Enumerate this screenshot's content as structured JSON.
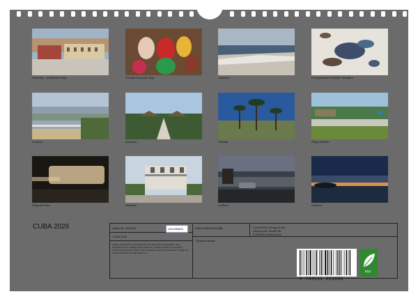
{
  "calendar": {
    "title": "CUBA 2026"
  },
  "photos": [
    {
      "caption": "Havanna - La Habana Vieja",
      "icon": "plaza-photo"
    },
    {
      "caption": "Trinidad Souvenir Shop",
      "icon": "souvenir-photo"
    },
    {
      "caption": "Varadero",
      "icon": "beach-photo"
    },
    {
      "caption": "Portugiesische Galeere, Varadero",
      "icon": "jellyfish-photo"
    },
    {
      "caption": "La Boca",
      "icon": "coast-photo"
    },
    {
      "caption": "Varadero",
      "icon": "huts-photo"
    },
    {
      "caption": "Trinidad",
      "icon": "palms-photo"
    },
    {
      "caption": "Playa del Este",
      "icon": "park-photo"
    },
    {
      "caption": "Playa del Este",
      "icon": "bus-night-photo"
    },
    {
      "caption": "Varadero",
      "icon": "villa-photo"
    },
    {
      "caption": "La Boca",
      "icon": "car-dusk-photo"
    },
    {
      "caption": "La Boca",
      "icon": "sunset-photo"
    }
  ],
  "info_panel": {
    "article_no": "Artikel-Nr. 2034654",
    "product_title": "CUBA 2026",
    "description": "Farbige Impressionen der Karibikinsel aus der Sicht des Fotografen. Eine besondere Reise in Bildern durch Havanna, Trinidad, Varadero und La Boca. Klimaneutral gedruckt. Motive ohne Textangabe auf den Monatsseiten. Verlag und Urheber behalten sich alle Rechte vor.",
    "isbn": "ISBN 9783516201888",
    "photographer": "Thomas Häusler",
    "publisher_name": "CALVENDO Verlag GmbH",
    "publisher_street": "Ottobrunner Straße 38",
    "publisher_city": "D-82008 Unterhaching",
    "logo_text": "CALVENDO"
  },
  "barcode": {
    "number": "9 783516 201888"
  },
  "eco_label": "eco",
  "colors": {
    "sheet": "#6b6b6b",
    "eco": "#2f8a2f"
  }
}
